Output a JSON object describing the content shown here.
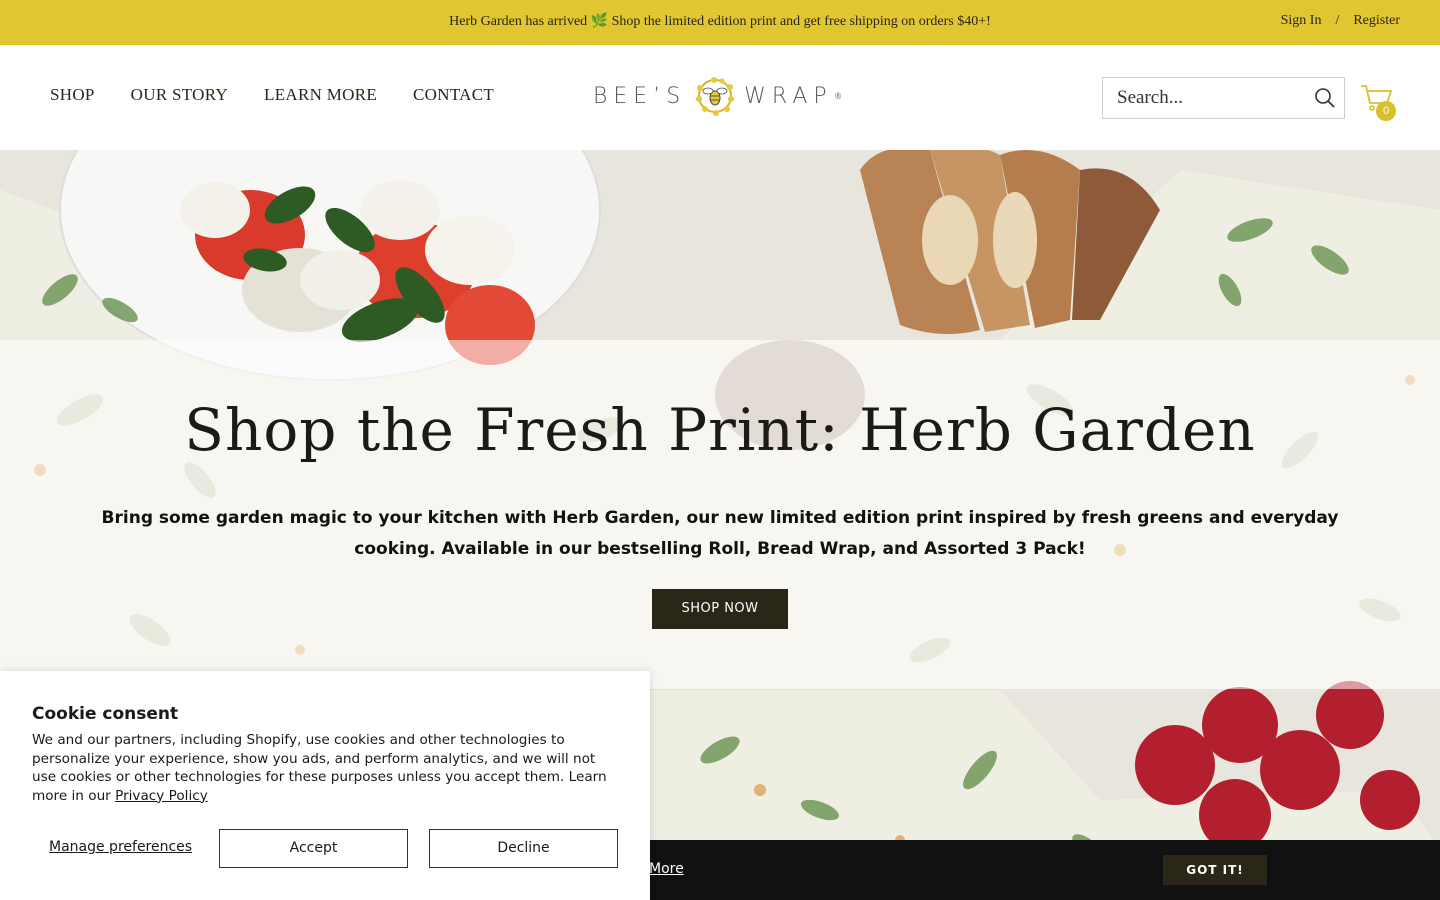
{
  "announcement": {
    "text": "Herb Garden has arrived 🌿 Shop the limited edition print and get free shipping on orders $40+!",
    "sign_in": "Sign In",
    "separator": "/",
    "register": "Register"
  },
  "header": {
    "nav": [
      "SHOP",
      "OUR STORY",
      "LEARN MORE",
      "CONTACT"
    ],
    "logo_left": "BEE’S",
    "logo_right": "WRAP",
    "logo_reg": "®",
    "search_placeholder": "Search...",
    "cart_count": "0"
  },
  "hero": {
    "title": "Shop the Fresh Print: Herb Garden",
    "description": "Bring some garden magic to your kitchen with Herb Garden, our new limited edition print inspired by fresh greens and everyday cooking. Available in our bestselling Roll, Bread Wrap, and Assorted 3 Pack!",
    "button": "SHOP NOW"
  },
  "cookie_strip": {
    "more_link": "More",
    "button": "GOT IT!"
  },
  "consent": {
    "title": "Cookie consent",
    "body": "We and our partners, including Shopify, use cookies and other technologies to personalize your experience, show you ads, and perform analytics, and we will not use cookies or other technologies for these purposes unless you accept them. Learn more in our",
    "privacy_link": "Privacy Policy",
    "manage": "Manage preferences",
    "accept": "Accept",
    "decline": "Decline"
  },
  "colors": {
    "announce_bg": "#e0c631",
    "button_dark": "#2a2618",
    "badge": "#d9bf2b"
  },
  "icons": [
    "search-icon",
    "cart-icon",
    "bee-logo-icon",
    "herb-icon"
  ]
}
